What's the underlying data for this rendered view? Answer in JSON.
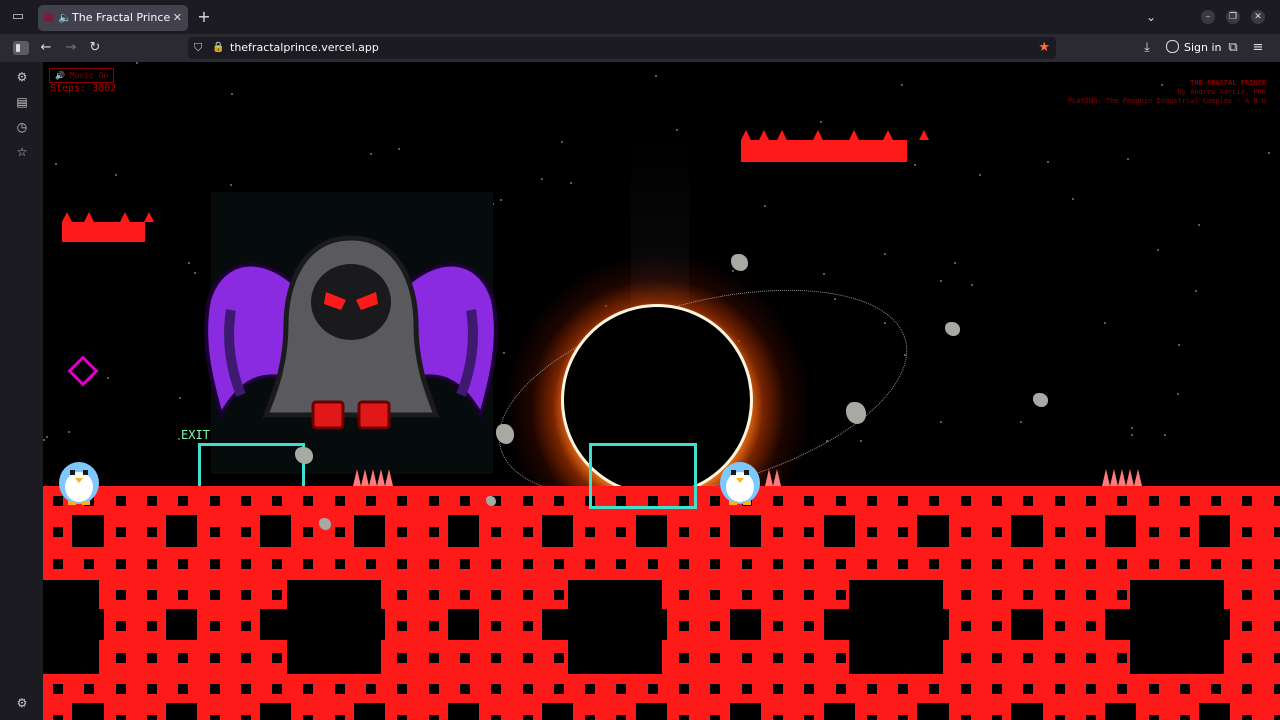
{
  "browser": {
    "tab": {
      "title": "The Fractal Prince",
      "audio_icon": "speaker-icon",
      "close_icon": "close-icon"
    },
    "new_tab_icon": "plus-icon",
    "url": "thefractalprince.vercel.app",
    "signin_label": "Sign in",
    "accent_color": "#ff7139"
  },
  "game": {
    "hud": {
      "music_label": "🔊 Music On",
      "steps_text": "Steps: 3802"
    },
    "credits": {
      "title": "THE FRACTAL PRINCE",
      "author": "by Andrew Garcia, PhD",
      "playing": "PLAYING: The Penguin Industrial Complex - A R G"
    },
    "exit_label": "EXIT",
    "colors": {
      "fractal_red": "#ff1a1a",
      "exit_cyan": "#40e0d0",
      "diamond_magenta": "#e000c8",
      "reaper_purple": "#8a2be2"
    }
  }
}
